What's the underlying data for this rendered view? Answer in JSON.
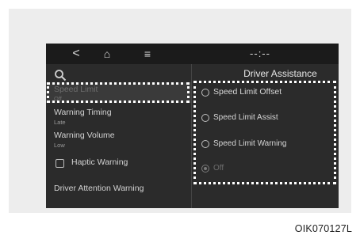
{
  "topbar": {
    "back_icon": "<",
    "home_icon": "⌂",
    "menu_icon": "≡",
    "time": "--:--"
  },
  "left": {
    "items": [
      {
        "label": "Speed Limit",
        "sub": "Off"
      },
      {
        "label": "Warning Timing",
        "sub": "Late"
      },
      {
        "label": "Warning Volume",
        "sub": "Low"
      },
      {
        "label": "Haptic Warning"
      },
      {
        "label": "Driver Attention Warning"
      }
    ]
  },
  "right": {
    "title": "Driver Assistance",
    "options": [
      {
        "label": "Speed Limit Offset"
      },
      {
        "label": "Speed Limit Assist"
      },
      {
        "label": "Speed Limit Warning"
      },
      {
        "label": "Off"
      }
    ]
  },
  "caption": "OIK070127L"
}
